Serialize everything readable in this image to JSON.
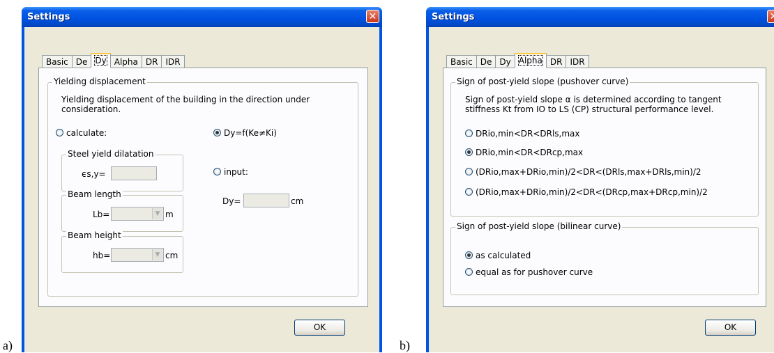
{
  "labels": {
    "a": "a)",
    "b": "b)"
  },
  "colors": {
    "titlebar": "#0054e3",
    "dialog_bg": "#ece9d8",
    "panel_bg": "#fcfcfe",
    "radio_dot": "#21a121",
    "close_button": "#d4472a"
  },
  "dialog_a": {
    "title": "Settings",
    "tabs": [
      "Basic",
      "De",
      "Dy",
      "Alpha",
      "DR",
      "IDR"
    ],
    "active_tab": "Dy",
    "group_title": "Yielding displacement",
    "description_line1": "Yielding displacement of the building in the direction under",
    "description_line2": "consideration.",
    "radio_calculate": "calculate:",
    "radio_dy_f": "Dy=f(Ke≠Ki)",
    "radio_input": "input:",
    "selected_radio": "Dy=f(Ke≠Ki)",
    "steel_group": "Steel yield dilatation",
    "steel_label": "ϵs,y=",
    "beam_length_group": "Beam length",
    "beam_length_label": "Lb=",
    "beam_length_unit": "m",
    "beam_height_group": "Beam height",
    "beam_height_label": "hb=",
    "beam_height_unit": "cm",
    "dy_label": "Dy=",
    "dy_unit": "cm",
    "ok": "OK"
  },
  "dialog_b": {
    "title": "Settings",
    "tabs": [
      "Basic",
      "De",
      "Dy",
      "Alpha",
      "DR",
      "IDR"
    ],
    "active_tab": "Alpha",
    "group1_title": "Sign of post-yield slope (pushover curve)",
    "group1_desc_line1": "Sign of post-yield slope α is determined according to tangent",
    "group1_desc_line2": "stiffness Kt from IO to LS (CP) structural performance level.",
    "options": [
      "DRio,min<DR<DRls,max",
      "DRio,min<DR<DRcp,max",
      "(DRio,max+DRio,min)/2<DR<(DRls,max+DRls,min)/2",
      "(DRio,max+DRio,min)/2<DR<(DRcp,max+DRcp,min)/2"
    ],
    "selected_option": "DRio,min<DR<DRcp,max",
    "group2_title": "Sign of post-yield slope (bilinear curve)",
    "bilinear_options": [
      "as calculated",
      "equal as for pushover curve"
    ],
    "selected_bilinear": "as calculated",
    "ok": "OK"
  }
}
